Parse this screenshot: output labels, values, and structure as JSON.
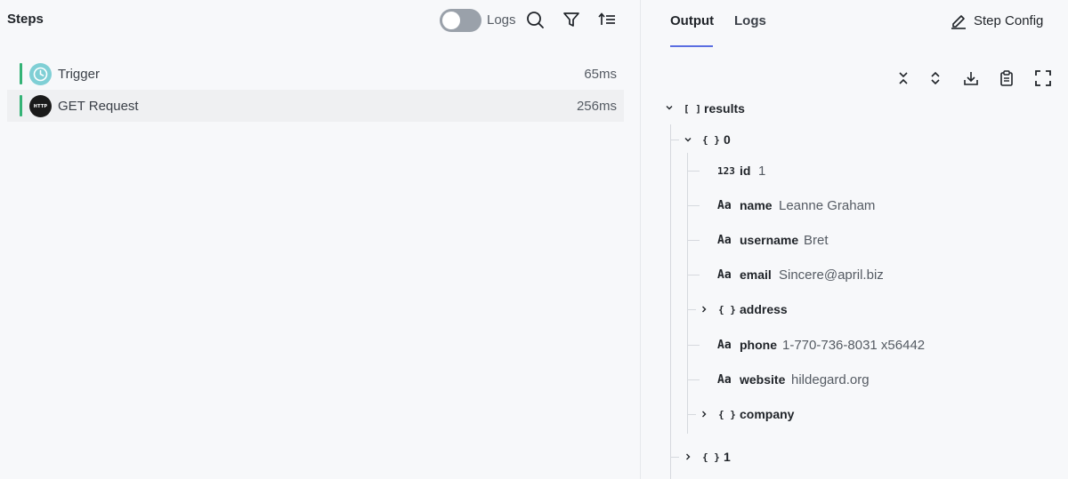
{
  "steps_panel": {
    "title": "Steps",
    "logs_toggle_label": "Logs",
    "logs_toggle_on": false,
    "steps": [
      {
        "name": "Trigger",
        "duration": "65ms",
        "icon": "clock-icon",
        "selected": false
      },
      {
        "name": "GET Request",
        "duration": "256ms",
        "icon": "http-icon",
        "icon_text": "HTTP",
        "selected": true
      }
    ]
  },
  "output_panel": {
    "tabs": [
      {
        "label": "Output",
        "active": true
      },
      {
        "label": "Logs",
        "active": false
      }
    ],
    "step_config_label": "Step Config",
    "tree": {
      "root_key": "results",
      "root_type": "[ ]",
      "item0_key": "0",
      "item0_type": "{ }",
      "fields": [
        {
          "type": "123",
          "key": "id",
          "value": "1"
        },
        {
          "type": "Aa",
          "key": "name",
          "value": "Leanne Graham"
        },
        {
          "type": "Aa",
          "key": "username",
          "value": "Bret"
        },
        {
          "type": "Aa",
          "key": "email",
          "value": "Sincere@april.biz"
        },
        {
          "type": "{ }",
          "key": "address",
          "value": ""
        },
        {
          "type": "Aa",
          "key": "phone",
          "value": "1-770-736-8031 x56442"
        },
        {
          "type": "Aa",
          "key": "website",
          "value": "hildegard.org"
        },
        {
          "type": "{ }",
          "key": "company",
          "value": ""
        }
      ],
      "item1_key": "1",
      "item1_type": "{ }"
    }
  },
  "colors": {
    "accent": "#5b6ee1",
    "step_bar": "#34b376",
    "trigger_icon_bg": "#7fcfd5"
  }
}
